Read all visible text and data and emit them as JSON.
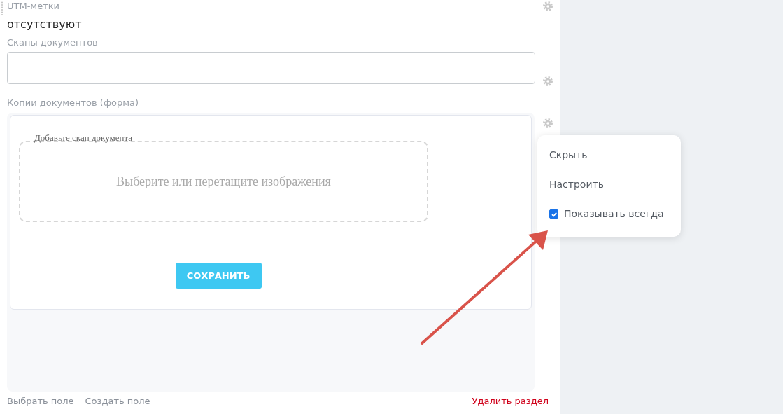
{
  "fields": [
    {
      "kind": "text",
      "label": "UTM-метки",
      "value": "отсутствуют"
    },
    {
      "kind": "input",
      "label": "Сканы документов"
    },
    {
      "kind": "form",
      "label": "Копии документов (форма)",
      "upload": {
        "legend": "Добавьте скан документа",
        "prompt": "Выберите или перетащите изображения"
      },
      "submit": "СОХРАНИТЬ"
    }
  ],
  "context_menu": {
    "items": [
      {
        "kind": "action",
        "label": "Скрыть"
      },
      {
        "kind": "action",
        "label": "Настроить"
      },
      {
        "kind": "checkbox",
        "label": "Показывать всегда",
        "checked": true
      }
    ]
  },
  "footer": {
    "links": [
      "Выбрать поле",
      "Создать поле"
    ],
    "danger_link": "Удалить раздел"
  }
}
